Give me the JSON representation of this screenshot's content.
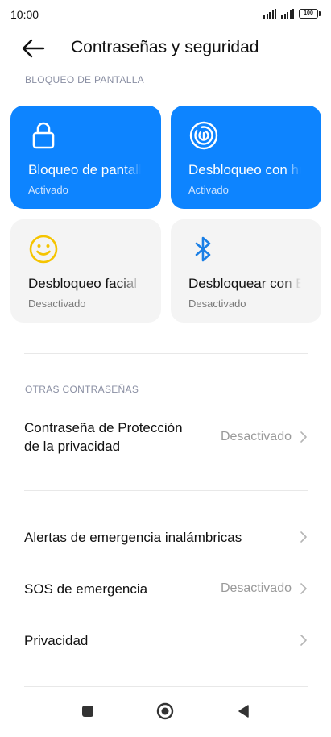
{
  "status_bar": {
    "time": "10:00",
    "battery": "100"
  },
  "header": {
    "title": "Contraseñas y seguridad"
  },
  "screen_lock": {
    "section_label": "BLOQUEO DE PANTALLA",
    "tiles": [
      {
        "title": "Bloqueo de pantalla",
        "status": "Activado",
        "icon": "lock-icon",
        "state": "active"
      },
      {
        "title": "Desbloqueo con huella",
        "status": "Activado",
        "icon": "fingerprint-icon",
        "state": "active"
      },
      {
        "title": "Desbloqueo facial",
        "status": "Desactivado",
        "icon": "face-smile-icon",
        "state": "inactive"
      },
      {
        "title": "Desbloquear con Bluetooth",
        "status": "Desactivado",
        "icon": "bluetooth-icon",
        "state": "inactive"
      }
    ]
  },
  "other_passwords": {
    "section_label": "OTRAS CONTRASEÑAS",
    "privacy_password": {
      "label_line1": "Contraseña de Protección",
      "label_line2": "de la privacidad",
      "value": "Desactivado"
    }
  },
  "menu": {
    "alerts": {
      "label": "Alertas de emergencia inalámbricas"
    },
    "sos": {
      "label": "SOS de emergencia",
      "value": "Desactivado"
    },
    "privacy": {
      "label": "Privacidad"
    }
  },
  "colors": {
    "accent": "#0d84ff",
    "face_icon": "#f5c400",
    "bluetooth_icon": "#1a7fe6"
  }
}
